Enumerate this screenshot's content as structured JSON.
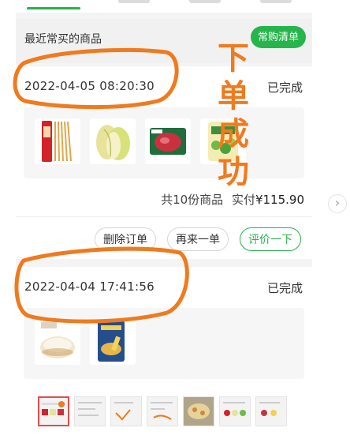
{
  "frequent": {
    "title": "最近常买的商品",
    "button_label": "常购清单"
  },
  "orders": [
    {
      "time": "2022-04-05 08:20:30",
      "status": "已完成",
      "summary_count": "共10份商品",
      "summary_paid": "实付",
      "summary_amount": "¥115.90",
      "items": [
        "spaghetti-pasta",
        "napa-cabbage",
        "minced-beef",
        "vegetable-pack"
      ]
    },
    {
      "time": "2022-04-04 17:41:56",
      "status": "已完成",
      "items": [
        "rice-bag",
        "snack-bag"
      ]
    }
  ],
  "actions": {
    "delete": "删除订单",
    "reorder": "再来一单",
    "review": "评价一下"
  },
  "annotation": {
    "chars": [
      "下",
      "单",
      "成",
      "功"
    ],
    "color": "#f07a1e"
  },
  "colors": {
    "accent": "#26b54a",
    "annotation": "#f07a1e",
    "active_thumb_border": "#e44b4b"
  },
  "icons": {
    "next": "chevron-right-icon"
  }
}
